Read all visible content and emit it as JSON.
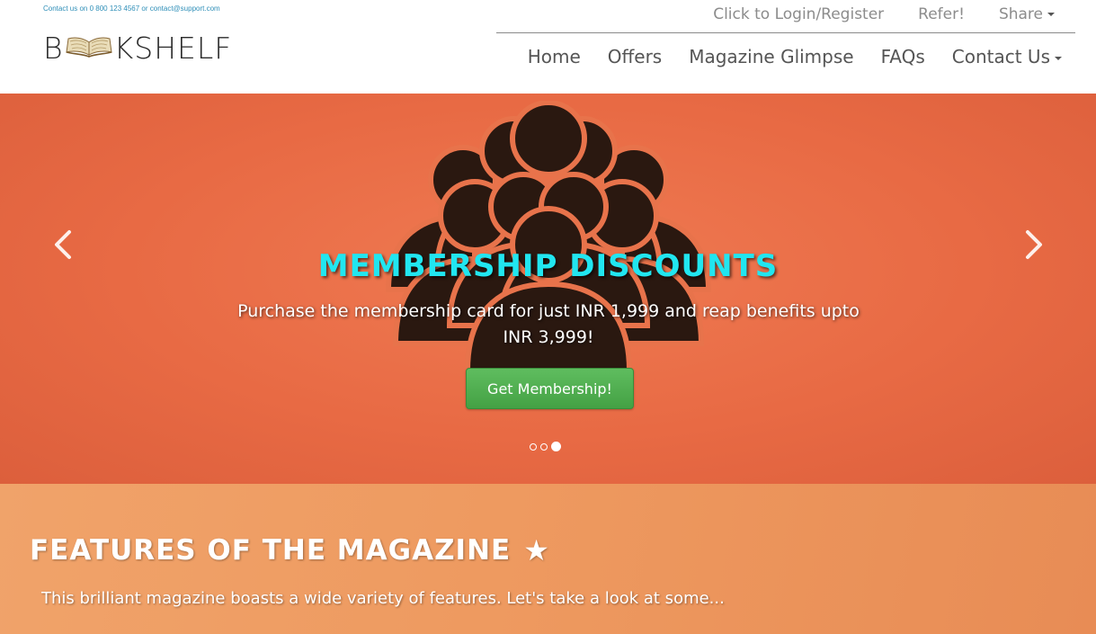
{
  "header": {
    "contact_line": "Contact us on 0 800 123 4567 or contact@support.com",
    "logo": {
      "prefix": "B",
      "suffix": "KSHELF"
    },
    "top_nav": [
      {
        "label": "Click to Login/Register"
      },
      {
        "label": "Refer!"
      },
      {
        "label": "Share"
      }
    ],
    "main_nav": [
      {
        "label": "Home"
      },
      {
        "label": "Offers"
      },
      {
        "label": "Magazine Glimpse"
      },
      {
        "label": "FAQs"
      },
      {
        "label": "Contact Us"
      }
    ]
  },
  "carousel": {
    "slide": {
      "title": "MEMBERSHIP DISCOUNTS",
      "text": "Purchase the membership card for just INR 1,999 and reap benefits upto INR 3,999!",
      "button_label": "Get Membership!"
    },
    "indicators_count": 3,
    "active_index": 2,
    "prev_label": "Previous",
    "next_label": "Next"
  },
  "features": {
    "title": "FEATURES OF THE MAGAZINE",
    "subtitle": "This brilliant magazine boasts a wide variety of features. Let's take a look at some..."
  },
  "colors": {
    "carousel_bg": "#e86a44",
    "slide_title": "#21e6f0",
    "cta_green": "#4cae4c",
    "features_bg": "#ee9a60",
    "contact_line": "#2f8fb8"
  }
}
